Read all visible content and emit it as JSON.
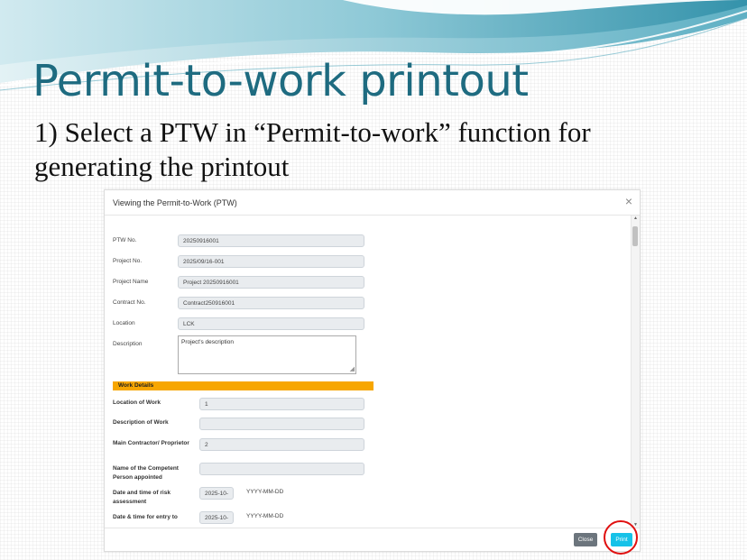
{
  "slide": {
    "title": "Permit-to-work printout",
    "subtitle": "1) Select a PTW in “Permit-to-work” function for generating the printout"
  },
  "modal": {
    "title": "Viewing the Permit-to-Work (PTW)",
    "close_glyph": "×",
    "fields": {
      "ptw_no": {
        "label": "PTW No.",
        "value": "20250916001"
      },
      "project_no": {
        "label": "Project No.",
        "value": "2025/09/16-001"
      },
      "project_name": {
        "label": "Project Name",
        "value": "Project 20250916001"
      },
      "contract_no": {
        "label": "Contract No.",
        "value": "Contract250916001"
      },
      "location": {
        "label": "Location",
        "value": "LCK"
      },
      "description": {
        "label": "Description",
        "value": "Project's description"
      }
    },
    "work_details": {
      "header": "Work Details",
      "location_of_work": {
        "label": "Location of Work",
        "value": "1"
      },
      "description_of_work": {
        "label": "Description of Work",
        "value": ""
      },
      "main_contractor": {
        "label": "Main Contractor/ Proprietor",
        "value": "2"
      },
      "competent_person": {
        "label": "Name of the Competent Person appointed",
        "value": ""
      },
      "risk_assessment": {
        "label": "Date and time of risk assessment",
        "value": "2025-10-",
        "hint": "YYYY-MM-DD"
      },
      "entry_datetime": {
        "label": "Date & time for entry to",
        "value": "2025-10-",
        "hint": "YYYY-MM-DD"
      }
    },
    "footer": {
      "close_label": "Close",
      "print_label": "Print"
    }
  },
  "colors": {
    "title": "#1e6b80",
    "section_bar": "#f7a600",
    "print_button": "#17c2e8",
    "close_button": "#6c757d",
    "highlight": "#e01010"
  }
}
